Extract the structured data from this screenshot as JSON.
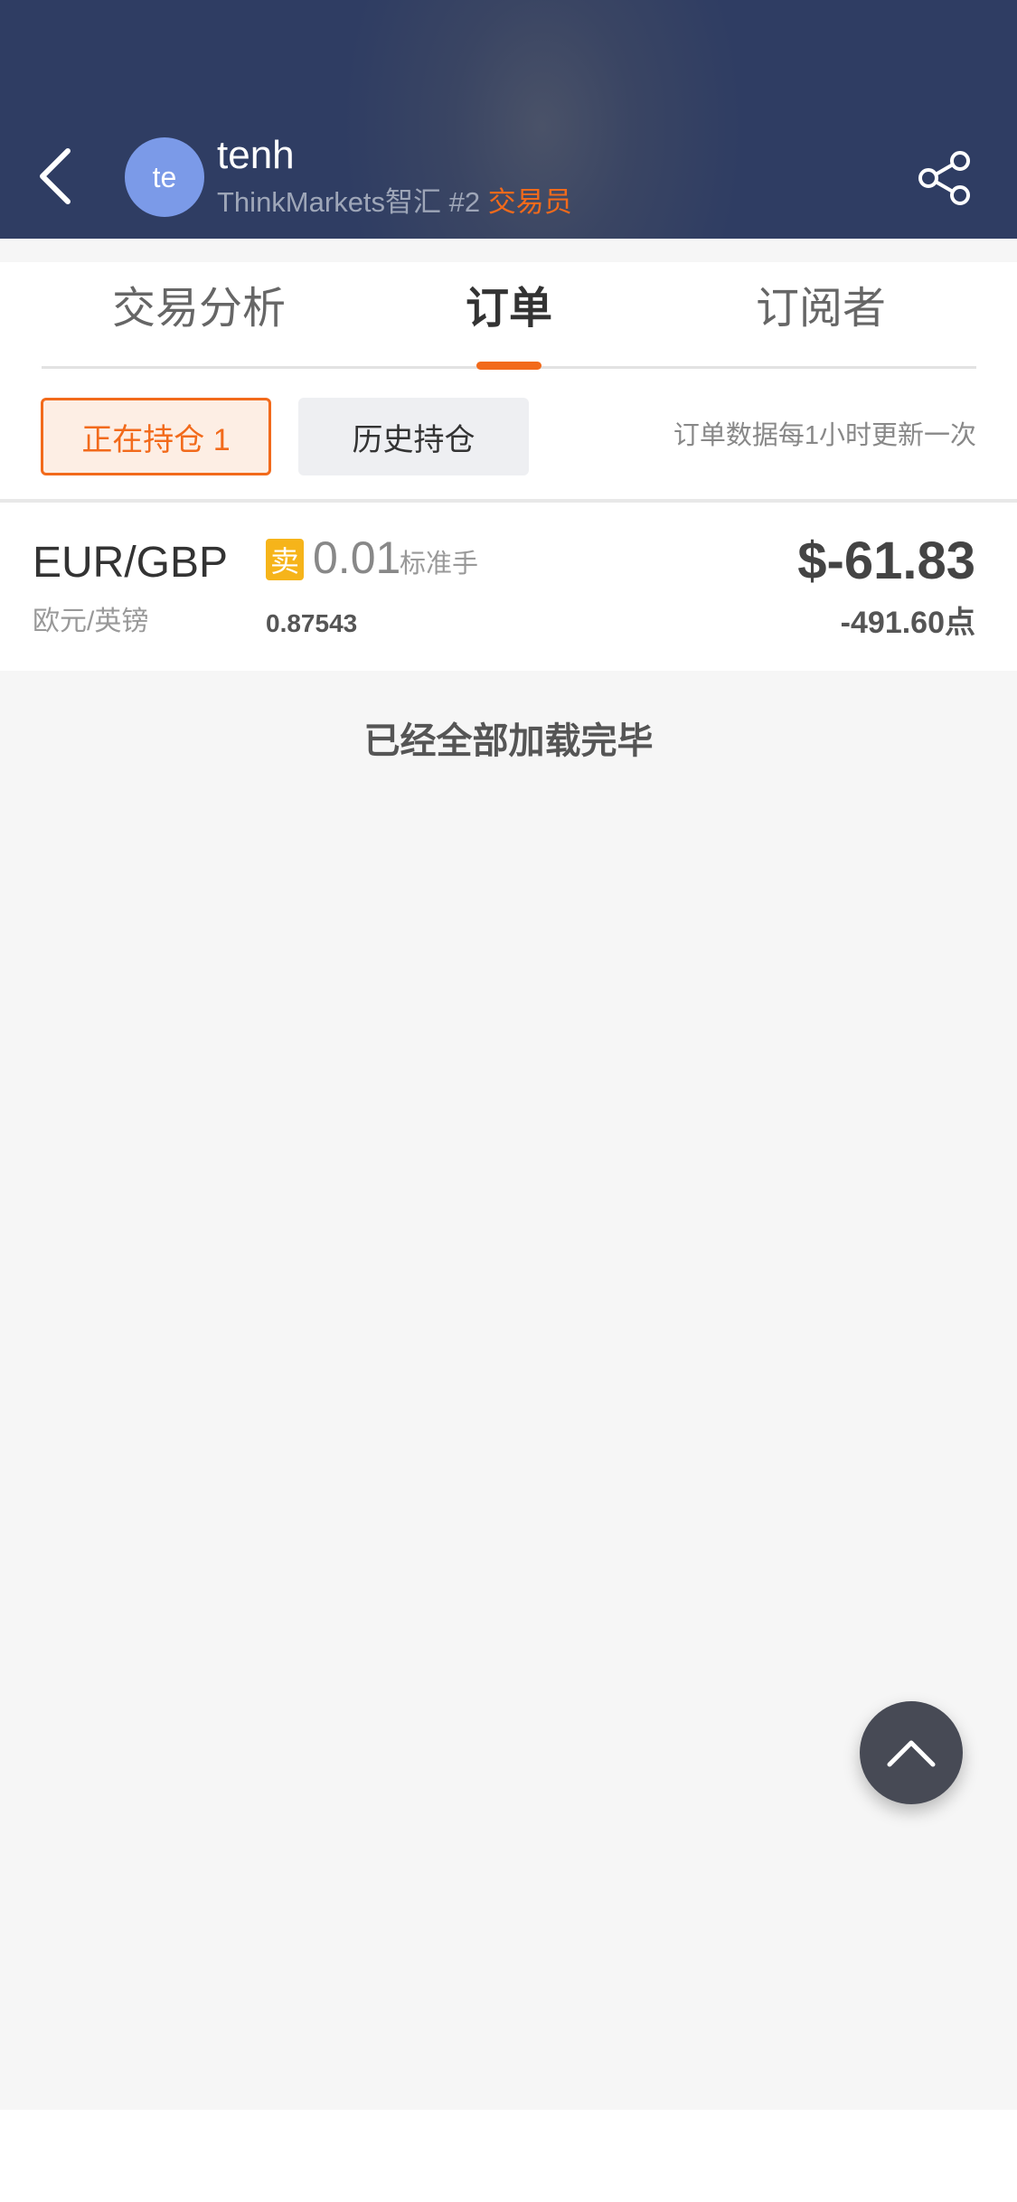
{
  "header": {
    "avatar_text": "te",
    "username": "tenh",
    "broker": "ThinkMarkets智汇",
    "rank": "#2",
    "role": "交易员",
    "background_color": "#2f3d63",
    "accent_color": "#f26a1b",
    "icons": [
      "back-icon",
      "share-icon"
    ]
  },
  "tabs": [
    {
      "label": "交易分析",
      "active": false
    },
    {
      "label": "订单",
      "active": true
    },
    {
      "label": "订阅者",
      "active": false
    }
  ],
  "filters": {
    "open_label": "正在持仓 1",
    "history_label": "历史持仓",
    "update_note": "订单数据每1小时更新一次"
  },
  "orders": [
    {
      "symbol": "EUR/GBP",
      "symbol_name": "欧元/英镑",
      "side": "卖",
      "side_color": "#f6b41a",
      "volume": "0.01",
      "volume_unit": "标准手",
      "open_price": "0.87543",
      "profit": "$-61.83",
      "points": "-491.60点"
    }
  ],
  "footer": {
    "loaded_message": "已经全部加载完毕",
    "scroll_top_icon": "chevron-up-icon"
  }
}
